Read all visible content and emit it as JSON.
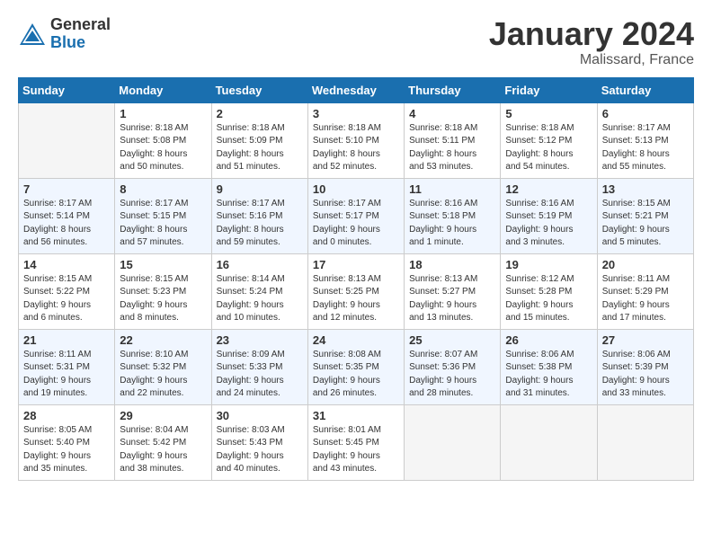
{
  "header": {
    "logo_general": "General",
    "logo_blue": "Blue",
    "month_title": "January 2024",
    "location": "Malissard, France"
  },
  "weekdays": [
    "Sunday",
    "Monday",
    "Tuesday",
    "Wednesday",
    "Thursday",
    "Friday",
    "Saturday"
  ],
  "weeks": [
    [
      {
        "num": "",
        "info": "",
        "empty": true
      },
      {
        "num": "1",
        "info": "Sunrise: 8:18 AM\nSunset: 5:08 PM\nDaylight: 8 hours\nand 50 minutes.",
        "empty": false
      },
      {
        "num": "2",
        "info": "Sunrise: 8:18 AM\nSunset: 5:09 PM\nDaylight: 8 hours\nand 51 minutes.",
        "empty": false
      },
      {
        "num": "3",
        "info": "Sunrise: 8:18 AM\nSunset: 5:10 PM\nDaylight: 8 hours\nand 52 minutes.",
        "empty": false
      },
      {
        "num": "4",
        "info": "Sunrise: 8:18 AM\nSunset: 5:11 PM\nDaylight: 8 hours\nand 53 minutes.",
        "empty": false
      },
      {
        "num": "5",
        "info": "Sunrise: 8:18 AM\nSunset: 5:12 PM\nDaylight: 8 hours\nand 54 minutes.",
        "empty": false
      },
      {
        "num": "6",
        "info": "Sunrise: 8:17 AM\nSunset: 5:13 PM\nDaylight: 8 hours\nand 55 minutes.",
        "empty": false
      }
    ],
    [
      {
        "num": "7",
        "info": "Sunrise: 8:17 AM\nSunset: 5:14 PM\nDaylight: 8 hours\nand 56 minutes.",
        "empty": false
      },
      {
        "num": "8",
        "info": "Sunrise: 8:17 AM\nSunset: 5:15 PM\nDaylight: 8 hours\nand 57 minutes.",
        "empty": false
      },
      {
        "num": "9",
        "info": "Sunrise: 8:17 AM\nSunset: 5:16 PM\nDaylight: 8 hours\nand 59 minutes.",
        "empty": false
      },
      {
        "num": "10",
        "info": "Sunrise: 8:17 AM\nSunset: 5:17 PM\nDaylight: 9 hours\nand 0 minutes.",
        "empty": false
      },
      {
        "num": "11",
        "info": "Sunrise: 8:16 AM\nSunset: 5:18 PM\nDaylight: 9 hours\nand 1 minute.",
        "empty": false
      },
      {
        "num": "12",
        "info": "Sunrise: 8:16 AM\nSunset: 5:19 PM\nDaylight: 9 hours\nand 3 minutes.",
        "empty": false
      },
      {
        "num": "13",
        "info": "Sunrise: 8:15 AM\nSunset: 5:21 PM\nDaylight: 9 hours\nand 5 minutes.",
        "empty": false
      }
    ],
    [
      {
        "num": "14",
        "info": "Sunrise: 8:15 AM\nSunset: 5:22 PM\nDaylight: 9 hours\nand 6 minutes.",
        "empty": false
      },
      {
        "num": "15",
        "info": "Sunrise: 8:15 AM\nSunset: 5:23 PM\nDaylight: 9 hours\nand 8 minutes.",
        "empty": false
      },
      {
        "num": "16",
        "info": "Sunrise: 8:14 AM\nSunset: 5:24 PM\nDaylight: 9 hours\nand 10 minutes.",
        "empty": false
      },
      {
        "num": "17",
        "info": "Sunrise: 8:13 AM\nSunset: 5:25 PM\nDaylight: 9 hours\nand 12 minutes.",
        "empty": false
      },
      {
        "num": "18",
        "info": "Sunrise: 8:13 AM\nSunset: 5:27 PM\nDaylight: 9 hours\nand 13 minutes.",
        "empty": false
      },
      {
        "num": "19",
        "info": "Sunrise: 8:12 AM\nSunset: 5:28 PM\nDaylight: 9 hours\nand 15 minutes.",
        "empty": false
      },
      {
        "num": "20",
        "info": "Sunrise: 8:11 AM\nSunset: 5:29 PM\nDaylight: 9 hours\nand 17 minutes.",
        "empty": false
      }
    ],
    [
      {
        "num": "21",
        "info": "Sunrise: 8:11 AM\nSunset: 5:31 PM\nDaylight: 9 hours\nand 19 minutes.",
        "empty": false
      },
      {
        "num": "22",
        "info": "Sunrise: 8:10 AM\nSunset: 5:32 PM\nDaylight: 9 hours\nand 22 minutes.",
        "empty": false
      },
      {
        "num": "23",
        "info": "Sunrise: 8:09 AM\nSunset: 5:33 PM\nDaylight: 9 hours\nand 24 minutes.",
        "empty": false
      },
      {
        "num": "24",
        "info": "Sunrise: 8:08 AM\nSunset: 5:35 PM\nDaylight: 9 hours\nand 26 minutes.",
        "empty": false
      },
      {
        "num": "25",
        "info": "Sunrise: 8:07 AM\nSunset: 5:36 PM\nDaylight: 9 hours\nand 28 minutes.",
        "empty": false
      },
      {
        "num": "26",
        "info": "Sunrise: 8:06 AM\nSunset: 5:38 PM\nDaylight: 9 hours\nand 31 minutes.",
        "empty": false
      },
      {
        "num": "27",
        "info": "Sunrise: 8:06 AM\nSunset: 5:39 PM\nDaylight: 9 hours\nand 33 minutes.",
        "empty": false
      }
    ],
    [
      {
        "num": "28",
        "info": "Sunrise: 8:05 AM\nSunset: 5:40 PM\nDaylight: 9 hours\nand 35 minutes.",
        "empty": false
      },
      {
        "num": "29",
        "info": "Sunrise: 8:04 AM\nSunset: 5:42 PM\nDaylight: 9 hours\nand 38 minutes.",
        "empty": false
      },
      {
        "num": "30",
        "info": "Sunrise: 8:03 AM\nSunset: 5:43 PM\nDaylight: 9 hours\nand 40 minutes.",
        "empty": false
      },
      {
        "num": "31",
        "info": "Sunrise: 8:01 AM\nSunset: 5:45 PM\nDaylight: 9 hours\nand 43 minutes.",
        "empty": false
      },
      {
        "num": "",
        "info": "",
        "empty": true
      },
      {
        "num": "",
        "info": "",
        "empty": true
      },
      {
        "num": "",
        "info": "",
        "empty": true
      }
    ]
  ]
}
